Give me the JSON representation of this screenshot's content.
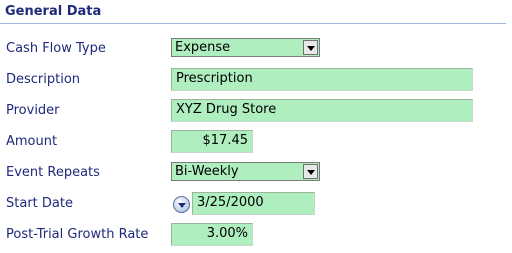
{
  "section": {
    "title": "General Data"
  },
  "fields": {
    "cash_flow_type": {
      "label": "Cash Flow Type",
      "value": "Expense"
    },
    "description": {
      "label": "Description",
      "value": "Prescription"
    },
    "provider": {
      "label": "Provider",
      "value": "XYZ Drug Store"
    },
    "amount": {
      "label": "Amount",
      "value": "$17.45"
    },
    "event_repeats": {
      "label": "Event Repeats",
      "value": "Bi-Weekly"
    },
    "start_date": {
      "label": "Start Date",
      "value": "3/25/2000"
    },
    "growth_rate": {
      "label": "Post-Trial Growth Rate",
      "value": "3.00%"
    }
  },
  "icons": {
    "dropdown": "chevron-down-icon",
    "calendar": "calendar-dropdown-icon"
  },
  "colors": {
    "field_bg": "#aeeebf",
    "label_text": "#1f2a7a",
    "rule": "#9fb6d6"
  }
}
